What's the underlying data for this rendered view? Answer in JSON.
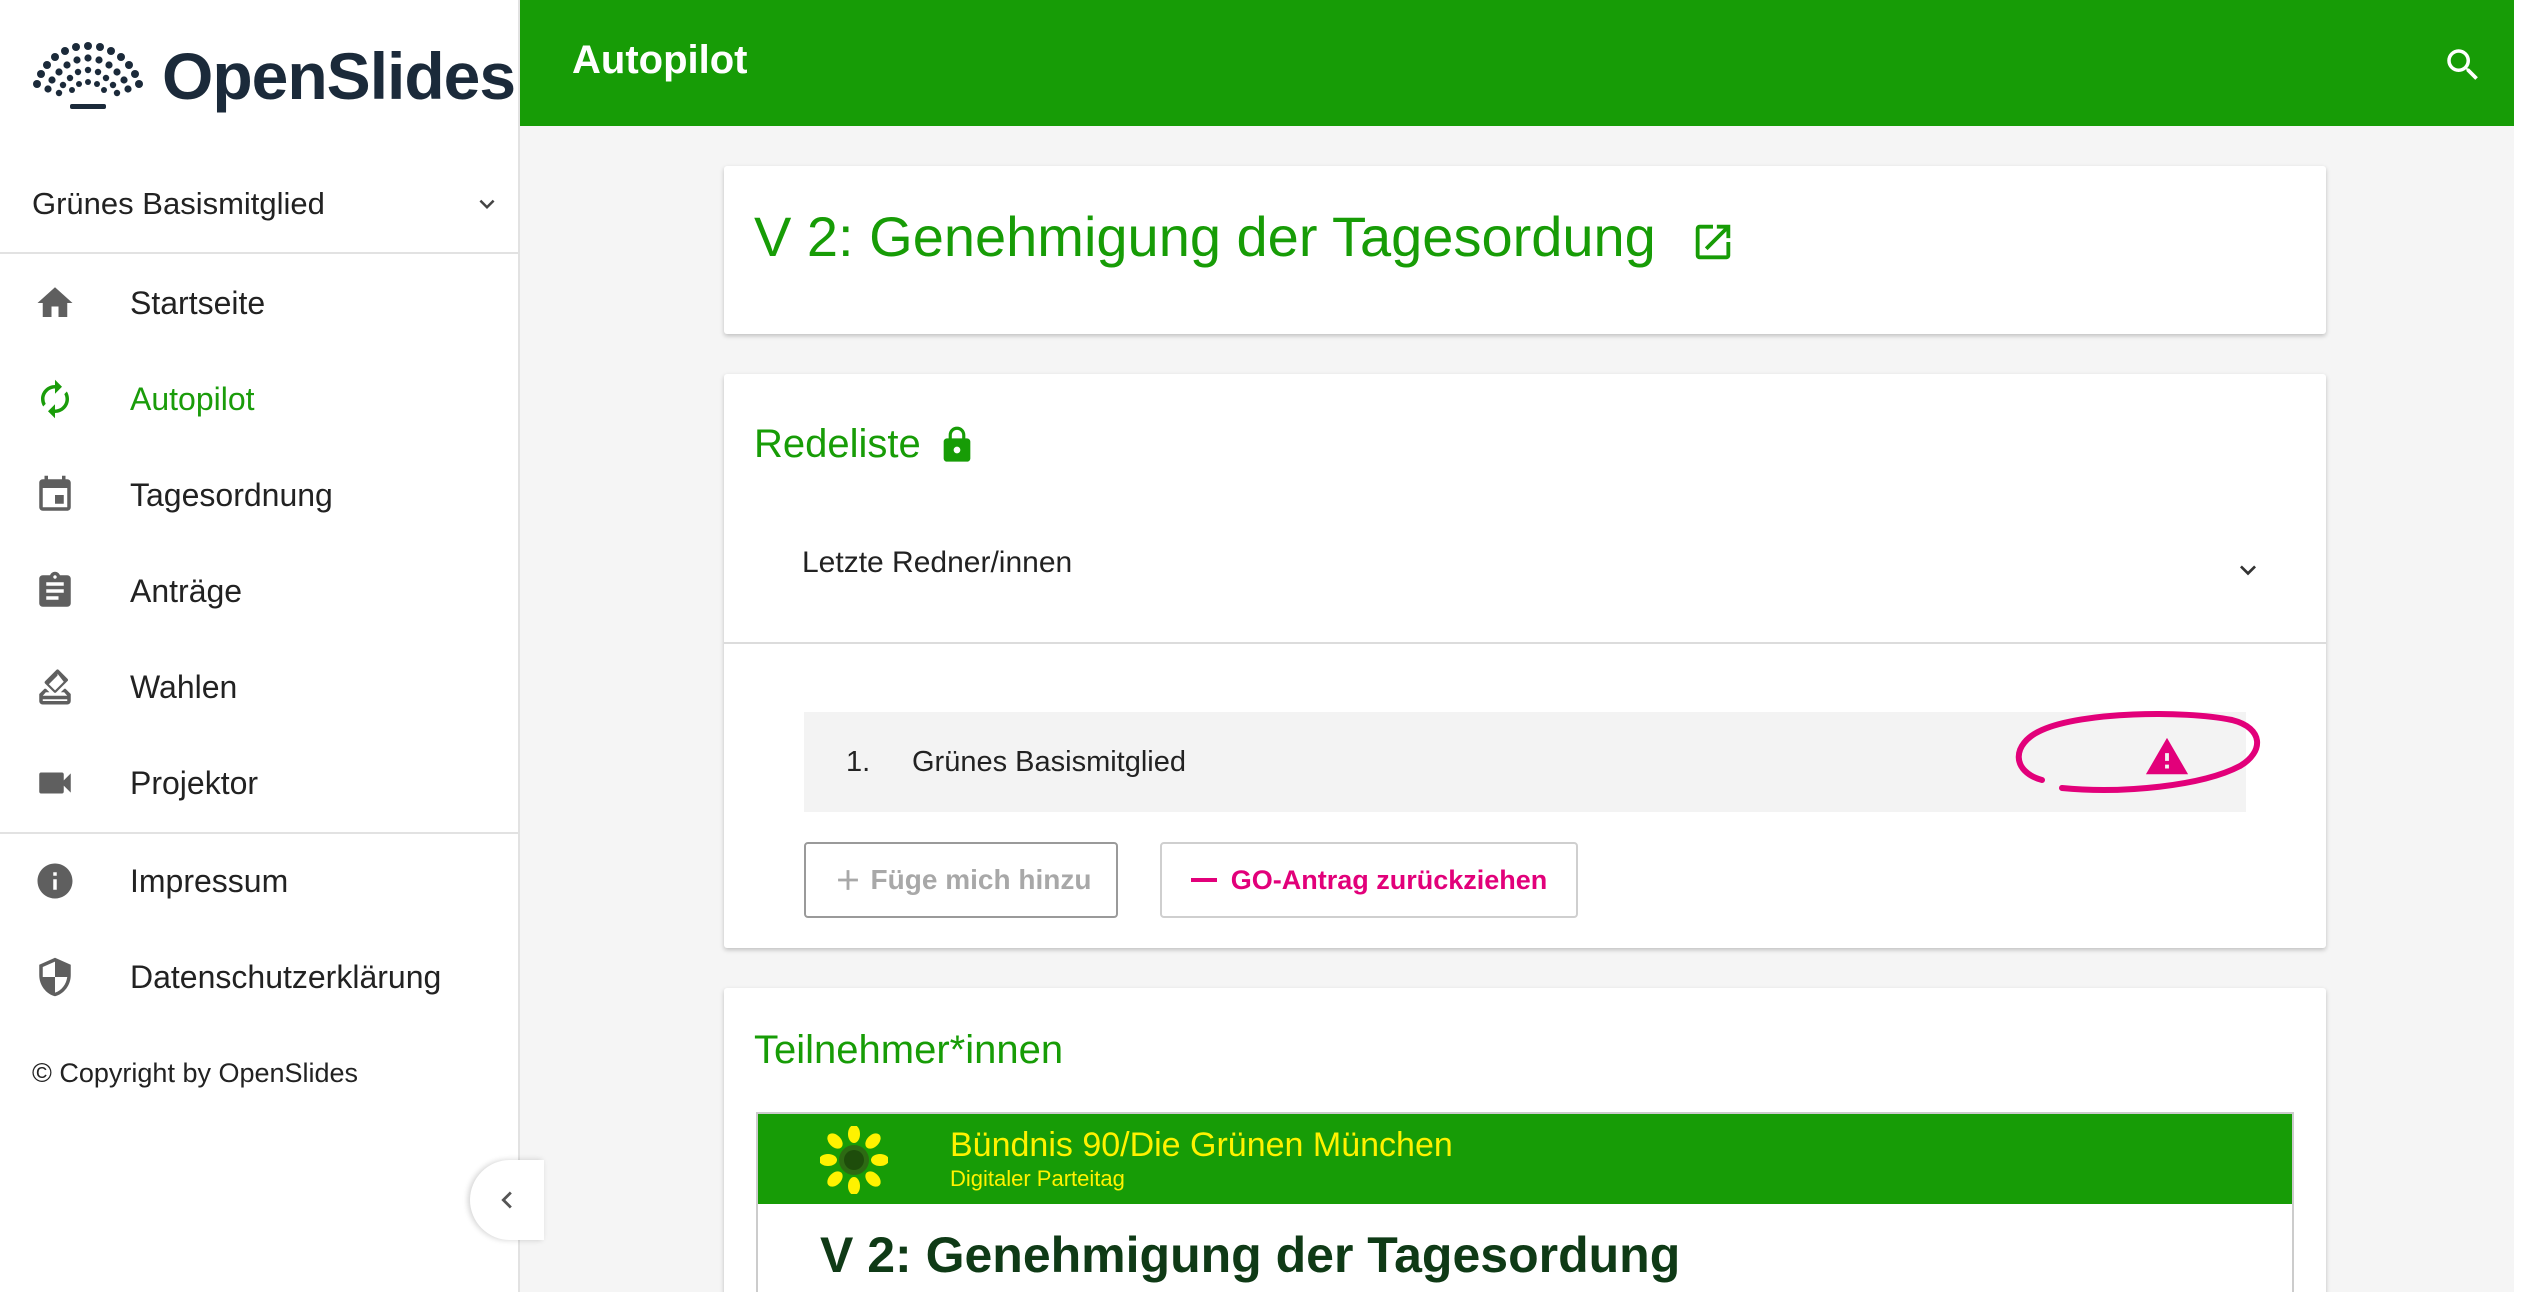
{
  "app": {
    "logo_text": "OpenSlides"
  },
  "header": {
    "title": "Autopilot"
  },
  "sidebar": {
    "user": "Grünes Basismitglied",
    "items": [
      {
        "label": "Startseite",
        "icon": "home-icon"
      },
      {
        "label": "Autopilot",
        "icon": "autorenew-icon",
        "active": true
      },
      {
        "label": "Tagesordnung",
        "icon": "calendar-icon"
      },
      {
        "label": "Anträge",
        "icon": "assignment-icon"
      },
      {
        "label": "Wahlen",
        "icon": "ballot-icon"
      },
      {
        "label": "Projektor",
        "icon": "videocam-icon"
      }
    ],
    "secondary": [
      {
        "label": "Impressum",
        "icon": "info-icon"
      },
      {
        "label": "Datenschutzerklärung",
        "icon": "shield-icon"
      }
    ],
    "copyright": "© Copyright by OpenSlides"
  },
  "topic": {
    "title": "V 2: Genehmigung der Tagesordung"
  },
  "speakers": {
    "heading": "Redeliste",
    "last_speakers_label": "Letzte Redner/innen",
    "list": [
      {
        "number": "1.",
        "name": "Grünes Basismitglied"
      }
    ],
    "add_button": "Füge mich hinzu",
    "withdraw_button": "GO-Antrag zurückziehen"
  },
  "participants": {
    "heading": "Teilnehmer*innen",
    "projector": {
      "org": "Bündnis 90/Die Grünen München",
      "event": "Digitaler Parteitag",
      "slide_title": "V 2: Genehmigung der Tagesordung"
    }
  },
  "colors": {
    "primary": "#179c06",
    "accent": "#e2007a",
    "brand_dark": "#1b2a3a",
    "projector_text": "#fff200"
  }
}
